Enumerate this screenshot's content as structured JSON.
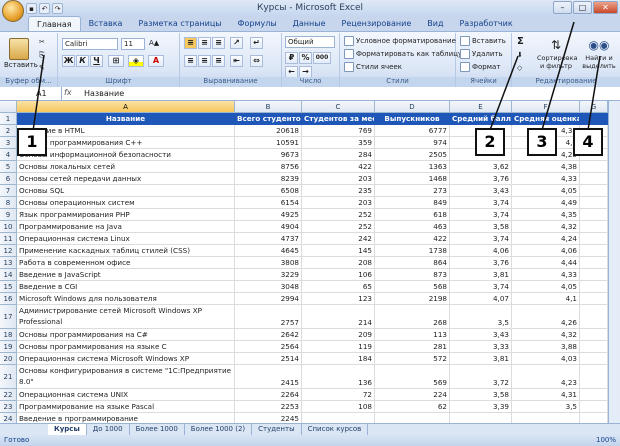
{
  "window": {
    "title": "Курсы - Microsoft Excel"
  },
  "tabs": [
    "Главная",
    "Вставка",
    "Разметка страницы",
    "Формулы",
    "Данные",
    "Рецензирование",
    "Вид",
    "Разработчик"
  ],
  "ribbon": {
    "clipboard": {
      "paste": "Вставить",
      "label": "Буфер обм..."
    },
    "font": {
      "name": "Calibri",
      "size": "11",
      "label": "Шрифт",
      "bold": "Ж",
      "italic": "К",
      "underline": "Ч"
    },
    "alignment": {
      "label": "Выравнивание"
    },
    "number": {
      "format": "Общий",
      "label": "Число",
      "percent": "%",
      "comma": "000"
    },
    "styles": {
      "conditional": "Условное форматирование",
      "table": "Форматировать как таблицу",
      "cell": "Стили ячеек",
      "label": "Стили"
    },
    "cells": {
      "insert": "Вставить",
      "delete": "Удалить",
      "format": "Формат",
      "label": "Ячейки"
    },
    "editing": {
      "sigma": "Σ",
      "sort": "Сортировка и фильтр",
      "find": "Найти и выделить",
      "label": "Редактирование"
    }
  },
  "formula_bar": {
    "name_box": "A1",
    "fx": "fx",
    "content": "Название"
  },
  "columns": [
    "A",
    "B",
    "C",
    "D",
    "E",
    "F",
    "G"
  ],
  "headers": [
    "Название",
    "Всего студентов",
    "Студентов за месяц",
    "Выпускников",
    "Средний балл",
    "Средняя оценка"
  ],
  "rows": [
    {
      "n": "2",
      "a": "Введение в HTML",
      "b": "20618",
      "c": "769",
      "d": "6777",
      "e": "",
      "f": "4,31"
    },
    {
      "n": "3",
      "a": "Основы программирования C++",
      "b": "10591",
      "c": "359",
      "d": "974",
      "e": "",
      "f": "4,0"
    },
    {
      "n": "4",
      "a": "Основы информационной безопасности",
      "b": "9673",
      "c": "284",
      "d": "2505",
      "e": "",
      "f": "4,25"
    },
    {
      "n": "5",
      "a": "Основы локальных сетей",
      "b": "8756",
      "c": "422",
      "d": "1363",
      "e": "3,62",
      "f": "4,38"
    },
    {
      "n": "6",
      "a": "Основы сетей передачи данных",
      "b": "8239",
      "c": "203",
      "d": "1468",
      "e": "3,76",
      "f": "4,33"
    },
    {
      "n": "7",
      "a": "Основы SQL",
      "b": "6508",
      "c": "235",
      "d": "273",
      "e": "3,43",
      "f": "4,05"
    },
    {
      "n": "8",
      "a": "Основы операционных систем",
      "b": "6154",
      "c": "203",
      "d": "849",
      "e": "3,74",
      "f": "4,49"
    },
    {
      "n": "9",
      "a": "Язык программирования PHP",
      "b": "4925",
      "c": "252",
      "d": "618",
      "e": "3,74",
      "f": "4,35"
    },
    {
      "n": "10",
      "a": "Программирование на Java",
      "b": "4904",
      "c": "252",
      "d": "463",
      "e": "3,58",
      "f": "4,32"
    },
    {
      "n": "11",
      "a": "Операционная система Linux",
      "b": "4737",
      "c": "242",
      "d": "422",
      "e": "3,74",
      "f": "4,24"
    },
    {
      "n": "12",
      "a": "Применение каскадных таблиц стилей (CSS)",
      "b": "4645",
      "c": "145",
      "d": "1738",
      "e": "4,06",
      "f": "4,06"
    },
    {
      "n": "13",
      "a": "Работа в современном офисе",
      "b": "3808",
      "c": "208",
      "d": "864",
      "e": "3,76",
      "f": "4,44"
    },
    {
      "n": "14",
      "a": "Введение в JavaScript",
      "b": "3229",
      "c": "106",
      "d": "873",
      "e": "3,81",
      "f": "4,33"
    },
    {
      "n": "15",
      "a": "Введение в CGI",
      "b": "3048",
      "c": "65",
      "d": "568",
      "e": "3,74",
      "f": "4,05"
    },
    {
      "n": "16",
      "a": "Microsoft Windows для пользователя",
      "b": "2994",
      "c": "123",
      "d": "2198",
      "e": "4,07",
      "f": "4,1"
    },
    {
      "n": "17",
      "a": "Администрирование сетей Microsoft Windows XP Professional",
      "b": "2757",
      "c": "214",
      "d": "268",
      "e": "3,5",
      "f": "4,26",
      "tall": true
    },
    {
      "n": "18",
      "a": "Основы программирования на C#",
      "b": "2642",
      "c": "209",
      "d": "113",
      "e": "3,43",
      "f": "4,32"
    },
    {
      "n": "19",
      "a": "Основы программирования на языке C",
      "b": "2564",
      "c": "119",
      "d": "281",
      "e": "3,33",
      "f": "3,88"
    },
    {
      "n": "20",
      "a": "Операционная система Microsoft Windows XP",
      "b": "2514",
      "c": "184",
      "d": "572",
      "e": "3,81",
      "f": "4,03"
    },
    {
      "n": "21",
      "a": "Основы конфигурирования в системе \"1С:Предприятие 8.0\"",
      "b": "2415",
      "c": "136",
      "d": "569",
      "e": "3,72",
      "f": "4,23",
      "tall": true
    },
    {
      "n": "22",
      "a": "Операционная система UNIX",
      "b": "2264",
      "c": "72",
      "d": "224",
      "e": "3,58",
      "f": "4,31"
    },
    {
      "n": "23",
      "a": "Программирование на языке Pascal",
      "b": "2253",
      "c": "108",
      "d": "62",
      "e": "3,39",
      "f": "3,5"
    },
    {
      "n": "24",
      "a": "Введение в программирование",
      "b": "2245",
      "c": "",
      "d": "",
      "e": "",
      "f": ""
    }
  ],
  "sheet_tabs": [
    "Курсы",
    "До 1000",
    "Более 1000",
    "Более 1000 (2)",
    "Студенты",
    "Список курсов"
  ],
  "status": {
    "ready": "Готово",
    "zoom": "100%"
  },
  "callouts": [
    "1",
    "2",
    "3",
    "4"
  ]
}
